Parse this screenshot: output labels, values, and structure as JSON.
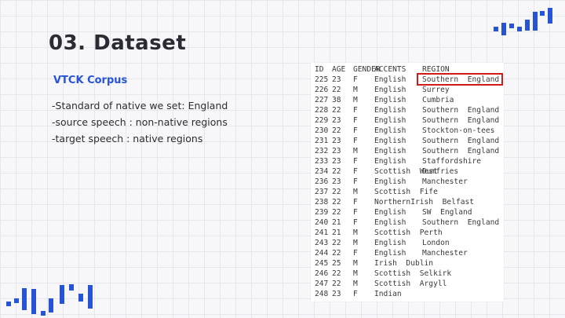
{
  "slide": {
    "title": "03. Dataset",
    "subtitle": "VTCK Corpus",
    "bullets": [
      "-Standard of native we set: England",
      "-source speech : non-native regions",
      "-target speech : native regions"
    ]
  },
  "table": {
    "headers": {
      "id": "ID",
      "age": "AGE",
      "gender": "GENDER",
      "accents": "ACCENTS",
      "region": "REGION"
    },
    "rows": [
      {
        "id": "225",
        "age": "23",
        "gender": "F",
        "accents": "English",
        "region": "Southern  England"
      },
      {
        "id": "226",
        "age": "22",
        "gender": "M",
        "accents": "English",
        "region": "Surrey"
      },
      {
        "id": "227",
        "age": "38",
        "gender": "M",
        "accents": "English",
        "region": "Cumbria"
      },
      {
        "id": "228",
        "age": "22",
        "gender": "F",
        "accents": "English",
        "region": "Southern  England"
      },
      {
        "id": "229",
        "age": "23",
        "gender": "F",
        "accents": "English",
        "region": "Southern  England"
      },
      {
        "id": "230",
        "age": "22",
        "gender": "F",
        "accents": "English",
        "region": "Stockton-on-tees"
      },
      {
        "id": "231",
        "age": "23",
        "gender": "F",
        "accents": "English",
        "region": "Southern  England"
      },
      {
        "id": "232",
        "age": "23",
        "gender": "M",
        "accents": "English",
        "region": "Southern  England"
      },
      {
        "id": "233",
        "age": "23",
        "gender": "F",
        "accents": "English",
        "region": "Staffordshire"
      },
      {
        "id": "234",
        "age": "22",
        "gender": "F",
        "accents": "Scottish  West",
        "region": "Dumfries"
      },
      {
        "id": "236",
        "age": "23",
        "gender": "F",
        "accents": "English",
        "region": "Manchester"
      },
      {
        "id": "237",
        "age": "22",
        "gender": "M",
        "accents": "Scottish  Fife",
        "region": ""
      },
      {
        "id": "238",
        "age": "22",
        "gender": "F",
        "accents": "NorthernIrish  Belfast",
        "region": ""
      },
      {
        "id": "239",
        "age": "22",
        "gender": "F",
        "accents": "English",
        "region": "SW  England"
      },
      {
        "id": "240",
        "age": "21",
        "gender": "F",
        "accents": "English",
        "region": "Southern  England"
      },
      {
        "id": "241",
        "age": "21",
        "gender": "M",
        "accents": "Scottish  Perth",
        "region": ""
      },
      {
        "id": "243",
        "age": "22",
        "gender": "M",
        "accents": "English",
        "region": "London"
      },
      {
        "id": "244",
        "age": "22",
        "gender": "F",
        "accents": "English",
        "region": "Manchester"
      },
      {
        "id": "245",
        "age": "25",
        "gender": "M",
        "accents": "Irish  Dublin",
        "region": ""
      },
      {
        "id": "246",
        "age": "22",
        "gender": "M",
        "accents": "Scottish  Selkirk",
        "region": ""
      },
      {
        "id": "247",
        "age": "22",
        "gender": "M",
        "accents": "Scottish  Argyll",
        "region": ""
      },
      {
        "id": "248",
        "age": "23",
        "gender": "F",
        "accents": "Indian",
        "region": ""
      }
    ]
  },
  "colors": {
    "accent": "#2753d6",
    "highlight": "#d11a1a",
    "text": "#2b2b33"
  }
}
